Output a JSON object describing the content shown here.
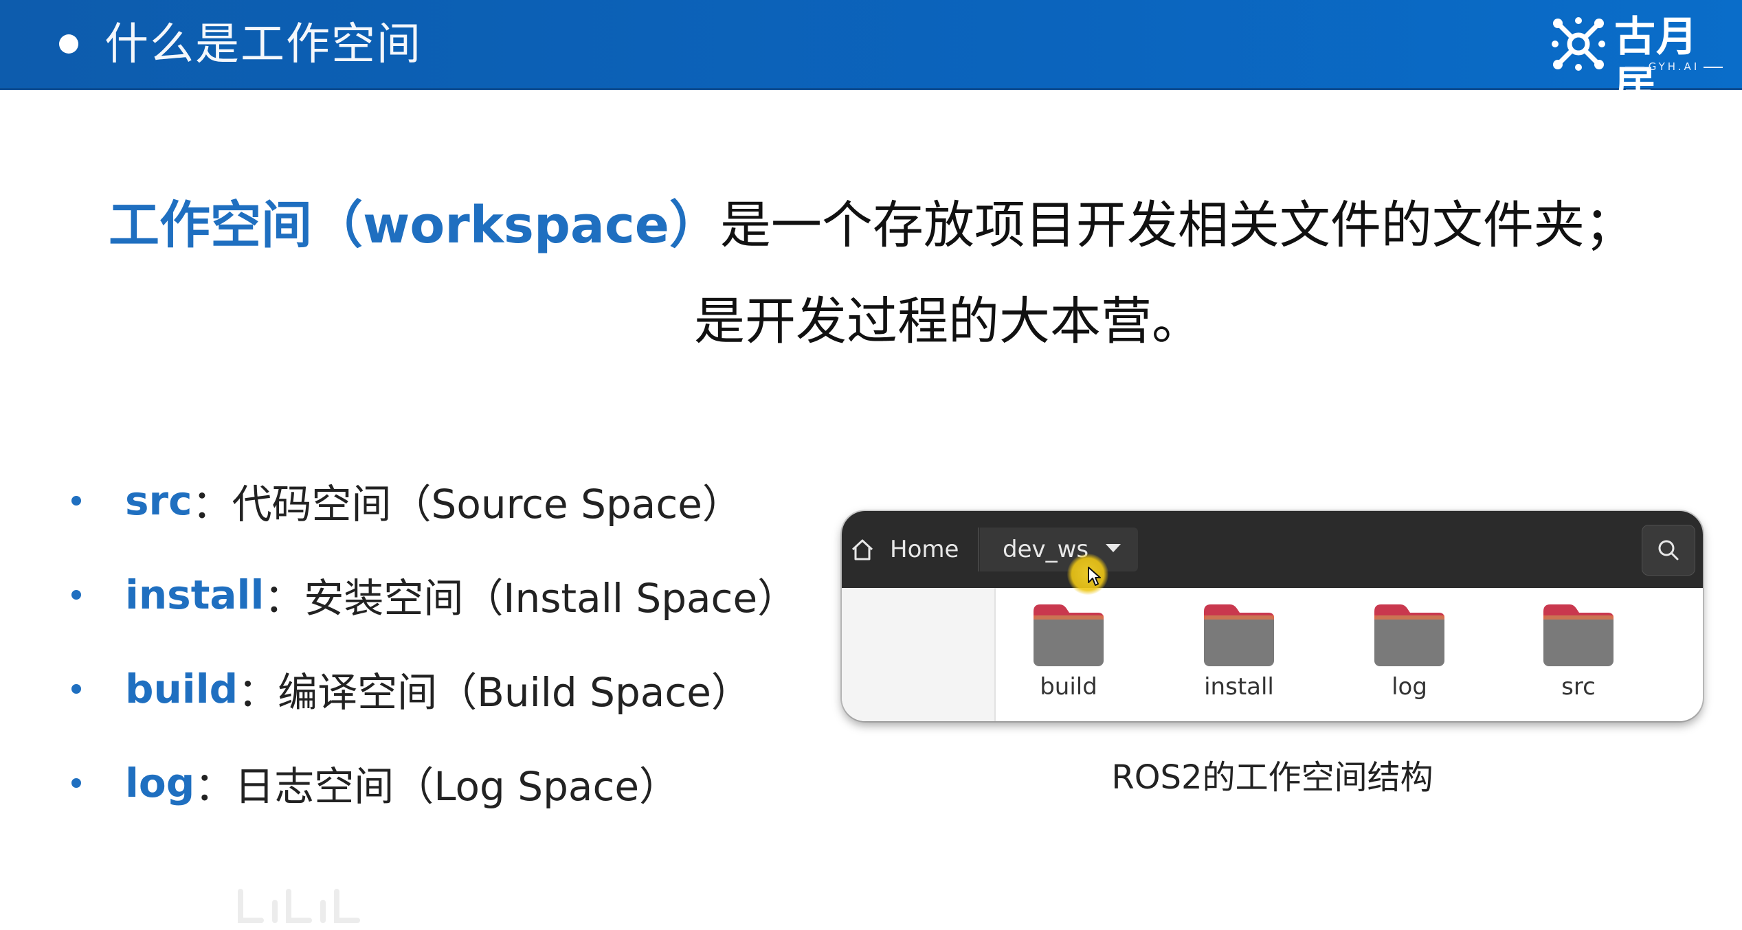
{
  "header": {
    "title": "什么是工作空间",
    "logo_text": "古月居",
    "logo_sub": "GYH.AI"
  },
  "definition": {
    "term": "工作空间（workspace）",
    "line1_rest": "是一个存放项目开发相关文件的文件夹；",
    "line2": "是开发过程的大本营。"
  },
  "bullets": [
    {
      "key": "src",
      "sep": "：",
      "text": "代码空间（Source Space）"
    },
    {
      "key": "install",
      "sep": "：",
      "text": "安装空间（Install Space）"
    },
    {
      "key": "build",
      "sep": "：",
      "text": "编译空间（Build Space）"
    },
    {
      "key": "log",
      "sep": "：",
      "text": "日志空间（Log Space）"
    }
  ],
  "file_manager": {
    "home_label": "Home",
    "current_folder": "dev_ws",
    "items": [
      {
        "label": "build"
      },
      {
        "label": "install"
      },
      {
        "label": "log"
      },
      {
        "label": "src"
      }
    ]
  },
  "caption": "ROS2的工作空间结构",
  "icons": {
    "home": "home-icon",
    "search": "search-icon",
    "dropdown": "chevron-down-icon",
    "folder": "folder-icon"
  },
  "colors": {
    "header_bg": "#0b64bd",
    "accent_blue": "#1f6fc0",
    "folder_tab": "#c9384e",
    "folder_body": "#7a7a7a",
    "cursor_highlight": "#f0c81c"
  }
}
